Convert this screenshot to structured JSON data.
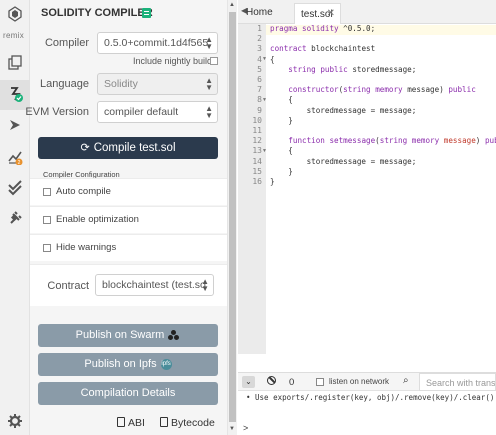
{
  "sidebar": {
    "logo_text": "remix",
    "badge_count": "2"
  },
  "compiler": {
    "header": "SOLIDITY COMPILER",
    "compiler_label": "Compiler",
    "compiler_value": "0.5.0+commit.1d4f565",
    "nightly_label": "Include nightly builds",
    "language_label": "Language",
    "language_value": "Solidity",
    "evm_label": "EVM Version",
    "evm_value": "compiler default",
    "compile_button": "Compile test.sol",
    "config_title": "Compiler Configuration",
    "options": [
      {
        "label": "Auto compile",
        "checked": false
      },
      {
        "label": "Enable optimization",
        "checked": false
      },
      {
        "label": "Hide warnings",
        "checked": false
      }
    ],
    "contract_label": "Contract",
    "contract_value": "blockchaintest (test.so",
    "publish_swarm": "Publish on Swarm",
    "publish_ipfs": "Publish on Ipfs",
    "ipfs_badge": "ipfs",
    "compilation_details": "Compilation Details",
    "abi_label": "ABI",
    "bytecode_label": "Bytecode"
  },
  "editor": {
    "tabs": [
      "Home",
      "test.sol"
    ],
    "line_numbers": [
      "1",
      "2",
      "3",
      "4",
      "5",
      "6",
      "7",
      "8",
      "9",
      "10",
      "11",
      "12",
      "13",
      "14",
      "15",
      "16"
    ],
    "fold_lines": [
      "4",
      "8",
      "13"
    ]
  },
  "terminal": {
    "counter": "0",
    "listen_label": "listen on network",
    "search_placeholder": "Search with transaction hash or address",
    "message": "Use exports/.register(key, obj)/.remove(key)/.clear() to",
    "prompt": ">"
  },
  "colors": {
    "compile_button_bg": "#2b3a4d",
    "secondary_button_bg": "#8a9ba8",
    "keyword": "#8b2dac",
    "variable": "#c0392b",
    "brand_green": "#1bb27b"
  }
}
